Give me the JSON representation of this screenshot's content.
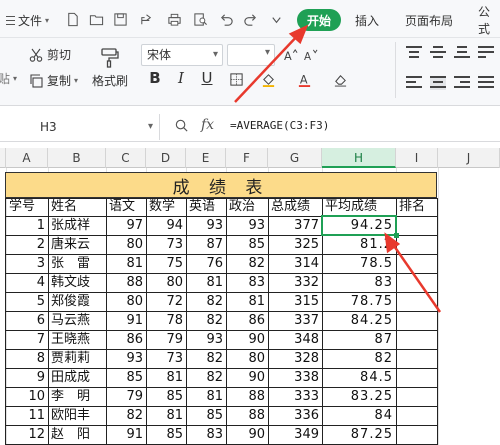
{
  "tabs": {
    "file": "文件",
    "home": "开始",
    "insert": "插入",
    "page_layout": "页面布局",
    "formulas": "公式"
  },
  "quick_access_icons": [
    "new-file-icon",
    "open-folder-icon",
    "save-icon",
    "print-icon",
    "print-preview-icon",
    "undo-icon",
    "redo-icon",
    "customize-icon"
  ],
  "ribbon": {
    "cut": "剪切",
    "copy": "复制",
    "paste_partial": "贴",
    "format_painter": "格式刷",
    "font_name": "宋体",
    "bold": "B",
    "italic": "I",
    "underline": "U"
  },
  "formula_bar": {
    "cell_ref": "H3",
    "fx": "fx",
    "formula": "=AVERAGE(C3:F3)"
  },
  "columns": [
    "A",
    "B",
    "C",
    "D",
    "E",
    "F",
    "G",
    "H",
    "I",
    "J"
  ],
  "selected_column": "H",
  "sheet": {
    "title": "成 绩 表",
    "headers": [
      "学号",
      "姓名",
      "语文",
      "数学",
      "英语",
      "政治",
      "总成绩",
      "平均成绩",
      "排名"
    ],
    "rows": [
      {
        "id": "1",
        "name": "张成祥",
        "chinese": "97",
        "math": "94",
        "english": "93",
        "politics": "93",
        "total": "377",
        "average": "94.25"
      },
      {
        "id": "2",
        "name": "唐来云",
        "chinese": "80",
        "math": "73",
        "english": "87",
        "politics": "85",
        "total": "325",
        "average": "81.2"
      },
      {
        "id": "3",
        "name": "张　雷",
        "chinese": "81",
        "math": "75",
        "english": "76",
        "politics": "82",
        "total": "314",
        "average": "78.5"
      },
      {
        "id": "4",
        "name": "韩文歧",
        "chinese": "88",
        "math": "80",
        "english": "81",
        "politics": "83",
        "total": "332",
        "average": "83"
      },
      {
        "id": "5",
        "name": "郑俊霞",
        "chinese": "80",
        "math": "72",
        "english": "82",
        "politics": "81",
        "total": "315",
        "average": "78.75"
      },
      {
        "id": "6",
        "name": "马云燕",
        "chinese": "91",
        "math": "78",
        "english": "82",
        "politics": "86",
        "total": "337",
        "average": "84.25"
      },
      {
        "id": "7",
        "name": "王晓燕",
        "chinese": "86",
        "math": "79",
        "english": "93",
        "politics": "90",
        "total": "348",
        "average": "87"
      },
      {
        "id": "8",
        "name": "贾莉莉",
        "chinese": "93",
        "math": "73",
        "english": "82",
        "politics": "80",
        "total": "328",
        "average": "82"
      },
      {
        "id": "9",
        "name": "田成成",
        "chinese": "85",
        "math": "81",
        "english": "82",
        "politics": "90",
        "total": "338",
        "average": "84.5"
      },
      {
        "id": "10",
        "name": "李　明",
        "chinese": "79",
        "math": "85",
        "english": "81",
        "politics": "88",
        "total": "333",
        "average": "83.25"
      },
      {
        "id": "11",
        "name": "欧阳丰",
        "chinese": "82",
        "math": "81",
        "english": "85",
        "politics": "88",
        "total": "336",
        "average": "84"
      },
      {
        "id": "12",
        "name": "赵　阳",
        "chinese": "91",
        "math": "85",
        "english": "83",
        "politics": "90",
        "total": "349",
        "average": "87.25"
      }
    ]
  },
  "colors": {
    "accent": "#1fa055",
    "title_fill": "#fcdb8a",
    "annotation_arrow": "#e8392d"
  }
}
